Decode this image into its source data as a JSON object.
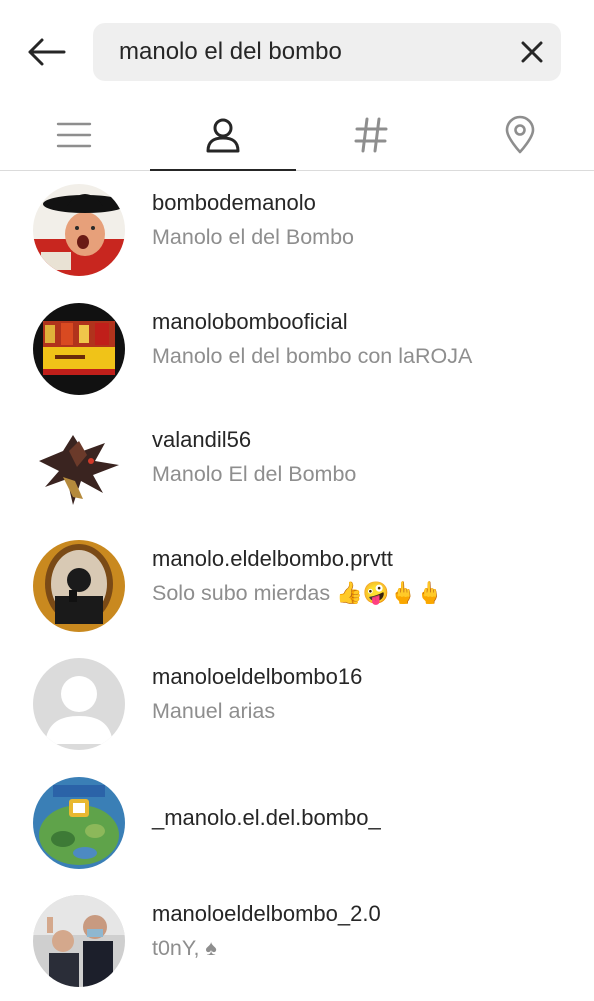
{
  "search": {
    "query": "manolo el del bombo",
    "back_icon": "arrow-left-icon",
    "clear_icon": "close-icon"
  },
  "tabs": [
    {
      "icon": "menu-lines-icon",
      "active": false
    },
    {
      "icon": "person-icon",
      "active": true
    },
    {
      "icon": "hashtag-icon",
      "active": false
    },
    {
      "icon": "location-pin-icon",
      "active": false
    }
  ],
  "results": [
    {
      "username": "bombodemanolo",
      "fullname": "Manolo el del Bombo",
      "avatar": "man-with-hat-photo"
    },
    {
      "username": "manolobombooficial",
      "fullname": "Manolo el del bombo con laROJA",
      "avatar": "spain-banner-photo"
    },
    {
      "username": "valandil56",
      "fullname": "Manolo El del Bombo",
      "avatar": "dragon-art"
    },
    {
      "username": "manolo.eldelbombo.prvtt",
      "fullname": "Solo subo mierdas 👍🤪🖕🖕",
      "avatar": "mirror-selfie-photo"
    },
    {
      "username": "manoloeldelbombo16",
      "fullname": "Manuel arias",
      "avatar": "default-avatar"
    },
    {
      "username": "_manolo.el.del.bombo_",
      "fullname": "",
      "avatar": "fortnite-map"
    },
    {
      "username": "manoloeldelbombo_2.0",
      "fullname": "t0nY, ♠",
      "avatar": "group-selfie-photo"
    }
  ],
  "colors": {
    "text_primary": "#262626",
    "text_secondary": "#8e8e8e",
    "search_bg": "#efefef",
    "divider": "#dbdbdb"
  }
}
